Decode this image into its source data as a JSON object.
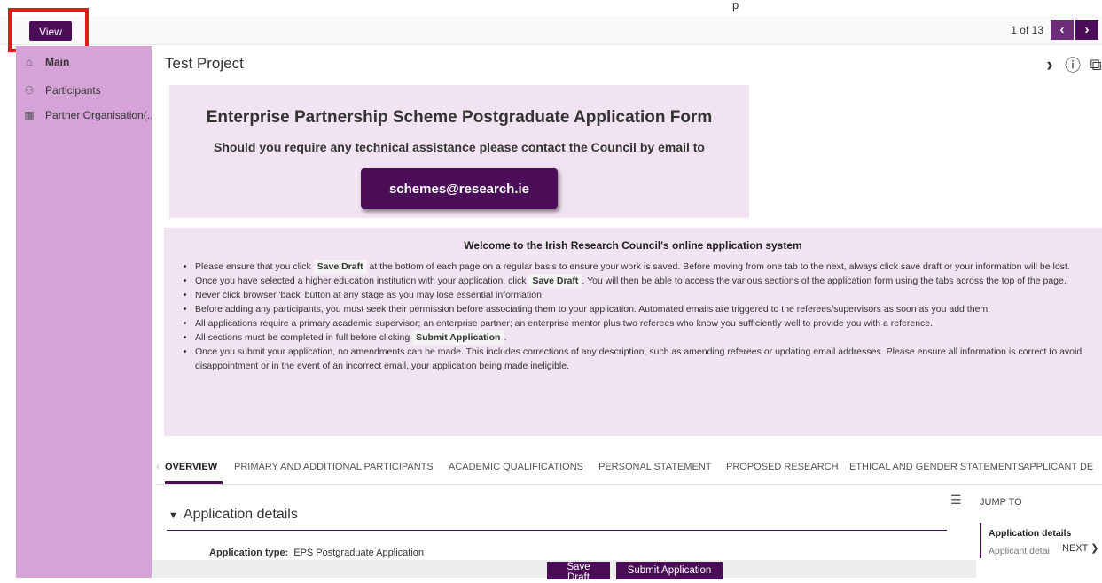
{
  "top_strip": {
    "glyph": "p"
  },
  "toolbar": {
    "view_label": "View",
    "pager_text": "1 of 13",
    "prev_label": "‹",
    "next_label": "›"
  },
  "sidebar": {
    "items": [
      {
        "label": "Main",
        "icon": "home-icon",
        "glyph": "⌂"
      },
      {
        "label": "Participants",
        "icon": "people-icon",
        "glyph": "⚇"
      },
      {
        "label": "Partner Organisation(...",
        "icon": "building-icon",
        "glyph": "▦"
      }
    ],
    "color": "#d6a3d9"
  },
  "page": {
    "title": "Test Project",
    "icons": {
      "expand": "›",
      "info": "ⓘ",
      "copy": "⧉"
    }
  },
  "banner": {
    "title": "Enterprise Partnership Scheme Postgraduate Application Form",
    "subtitle": "Should you require any technical assistance please contact the Council by email to",
    "email": "schemes@research.ie"
  },
  "welcome": {
    "title": "Welcome to the Irish Research Council's online application system",
    "bullets": [
      {
        "before": "Please ensure that you click ",
        "kw": "Save Draft",
        "after": " at the bottom of each page on a regular basis to ensure your work is saved. Before moving from one tab to the next, always click save draft or your information will be lost."
      },
      {
        "before": "Once you have selected a higher education institution with your application, click ",
        "kw": "Save Draft",
        "after": ". You will then be able to access the various sections of the application form using the tabs across the top of the page."
      },
      {
        "before": "Never click browser 'back' button at any stage as you may lose essential information.",
        "kw": "",
        "after": ""
      },
      {
        "before": "Before adding any participants, you must seek their permission before associating them to your application. Automated emails are triggered to the referees/supervisors as soon as you add them.",
        "kw": "",
        "after": ""
      },
      {
        "before": "All applications require a primary academic supervisor; an enterprise partner; an enterprise mentor plus two referees who know you sufficiently well to provide you with a reference.",
        "kw": "",
        "after": ""
      },
      {
        "before": "All sections must be completed in full before clicking ",
        "kw": "Submit Application",
        "after": "."
      },
      {
        "before": "Once you submit your application, no amendments can be made. This includes corrections of any description, such as amending referees or updating email addresses. Please ensure all information is correct to avoid disappointment or in the event of an incorrect email, your application being made ineligible.",
        "kw": "",
        "after": ""
      }
    ]
  },
  "tabs": [
    {
      "label": "OVERVIEW",
      "active": true
    },
    {
      "label": "PRIMARY AND ADDITIONAL PARTICIPANTS"
    },
    {
      "label": "ACADEMIC QUALIFICATIONS"
    },
    {
      "label": "PERSONAL STATEMENT"
    },
    {
      "label": "PROPOSED RESEARCH"
    },
    {
      "label": "ETHICAL AND GENDER STATEMENTS"
    },
    {
      "label": "APPLICANT DE"
    }
  ],
  "section": {
    "title": "Application details",
    "field_label": "Application type:",
    "field_value": "EPS Postgraduate Application"
  },
  "jump": {
    "title": "JUMP TO",
    "items": [
      "Application details",
      "Applicant detai"
    ],
    "next_label": "NEXT"
  },
  "footer": {
    "save_label": "Save Draft",
    "submit_label": "Submit Application"
  },
  "colors": {
    "brand": "#4b0d57",
    "sidebar": "#d6a3d9",
    "panel": "#f1e3f2",
    "highlight": "#e31b1b"
  }
}
